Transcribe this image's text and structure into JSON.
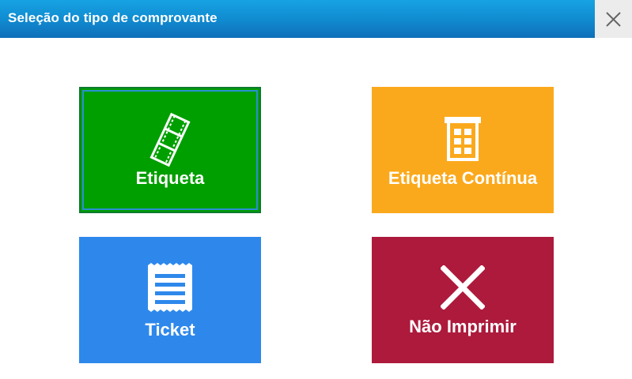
{
  "dialog": {
    "title": "Seleção do tipo de comprovante",
    "close_icon": "close-icon"
  },
  "options": [
    {
      "label": "Etiqueta",
      "icon": "film-strip-icon",
      "color": "#009f00",
      "selected": true
    },
    {
      "label": "Etiqueta Contínua",
      "icon": "label-roll-icon",
      "color": "#fba91c",
      "selected": false
    },
    {
      "label": "Ticket",
      "icon": "receipt-icon",
      "color": "#2e88ec",
      "selected": false
    },
    {
      "label": "Não Imprimir",
      "icon": "x-icon",
      "color": "#ad1a3c",
      "selected": false
    }
  ],
  "colors": {
    "titlebar": "#1089cf",
    "selection_outline": "#2a8fd0"
  }
}
